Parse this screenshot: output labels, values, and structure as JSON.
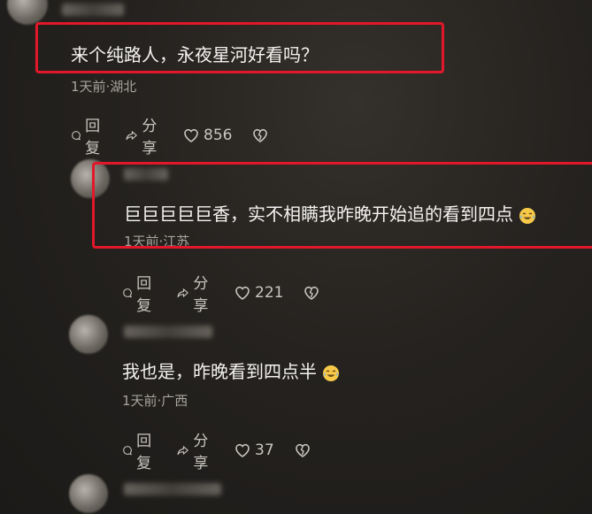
{
  "comments": [
    {
      "text": "来个纯路人，永夜星河好看吗？",
      "meta": "1天前·湖北",
      "reply_label": "回复",
      "share_label": "分享",
      "likes": "856"
    },
    {
      "text": "巨巨巨巨巨香，实不相瞒我昨晚开始追的看到四点",
      "meta": "1天前·江苏",
      "reply_label": "回复",
      "share_label": "分享",
      "likes": "221"
    },
    {
      "text": "我也是，昨晚看到四点半",
      "meta": "1天前·广西",
      "reply_label": "回复",
      "share_label": "分享",
      "likes": "37"
    }
  ],
  "icons": {
    "reply": "comment-bubble-icon",
    "share": "share-arrow-icon",
    "like": "heart-icon",
    "dislike": "broken-heart-icon",
    "emoji": "laugh-cry-emoji"
  },
  "colors": {
    "highlight_box": "#e2182a",
    "meta_text": "#a7a39d"
  }
}
